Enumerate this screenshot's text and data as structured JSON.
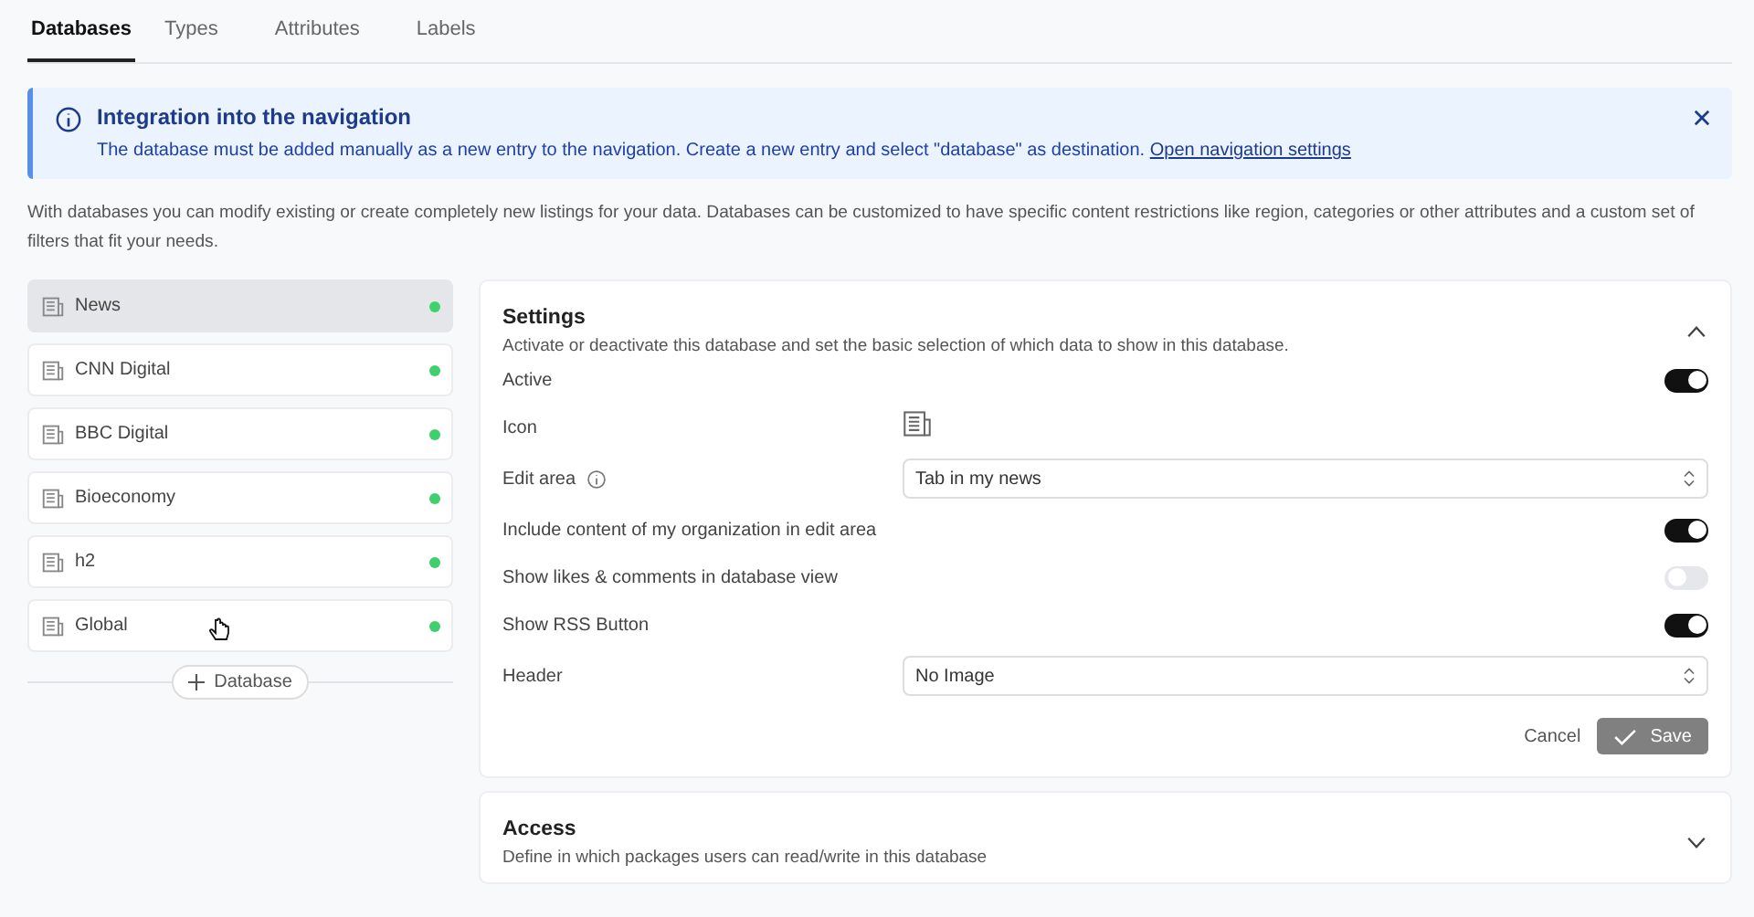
{
  "tabs": [
    {
      "label": "Databases",
      "selected": true
    },
    {
      "label": "Types",
      "selected": false
    },
    {
      "label": "Attributes",
      "selected": false
    },
    {
      "label": "Labels",
      "selected": false
    }
  ],
  "banner": {
    "title": "Integration into the navigation",
    "text": "The database must be added manually as a new entry to the navigation. Create a new entry and select \"database\" as destination.",
    "link": "Open navigation settings"
  },
  "intro": "With databases you can modify existing or create completely new listings for your data. Databases can be customized to have specific content restrictions like region, categories or other attributes and a custom set of filters that fit your needs.",
  "databases": [
    {
      "name": "News",
      "selected": true,
      "color": "#3ed16b"
    },
    {
      "name": "CNN Digital",
      "selected": false,
      "color": "#3ed16b"
    },
    {
      "name": "BBC Digital",
      "selected": false,
      "color": "#3ed16b"
    },
    {
      "name": "Bioeconomy",
      "selected": false,
      "color": "#3ed16b"
    },
    {
      "name": "h2",
      "selected": false,
      "color": "#3ed16b"
    },
    {
      "name": "Global",
      "selected": false,
      "color": "#3ed16b"
    }
  ],
  "add_button": "Database",
  "settings": {
    "title": "Settings",
    "description": "Activate or deactivate this database and set the basic selection of which data to show in this database.",
    "expanded": true,
    "rows": [
      {
        "kind": "toggle",
        "label": "Active",
        "on": true
      },
      {
        "kind": "icon",
        "label": "Icon"
      },
      {
        "kind": "select",
        "label": "Edit area",
        "info": true,
        "value": "Tab in my news"
      },
      {
        "kind": "toggle",
        "label": "Include content of my organization in edit area",
        "on": true
      },
      {
        "kind": "toggle",
        "label": "Show likes & comments in database view",
        "on": false
      },
      {
        "kind": "toggle",
        "label": "Show RSS Button",
        "on": true
      },
      {
        "kind": "select",
        "label": "Header",
        "value": "No Image"
      }
    ],
    "cancel": "Cancel",
    "save": "Save"
  },
  "access": {
    "title": "Access",
    "description": "Define in which packages users can read/write in this database",
    "expanded": false
  }
}
